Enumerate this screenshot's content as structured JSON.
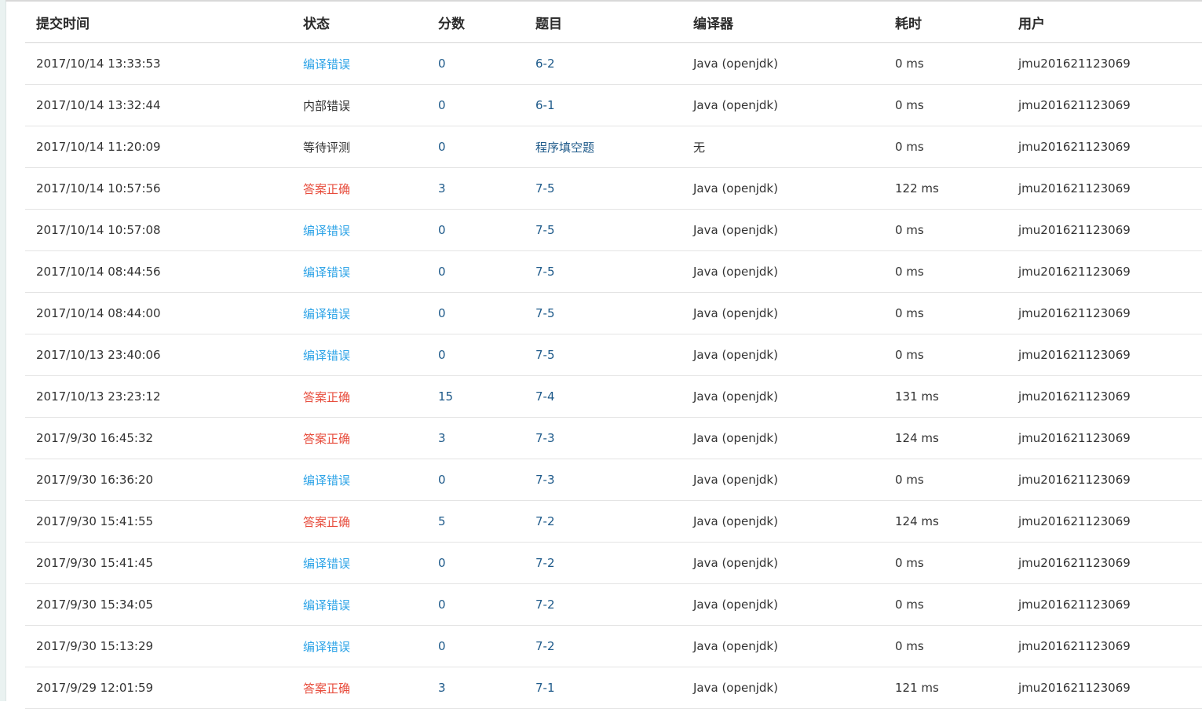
{
  "headers": {
    "time": "提交时间",
    "status": "状态",
    "score": "分数",
    "problem": "题目",
    "compiler": "编译器",
    "cost": "耗时",
    "user": "用户"
  },
  "rows": [
    {
      "time": "2017/10/14 13:33:53",
      "status": "编译错误",
      "status_type": "ce",
      "score": "0",
      "problem": "6-2",
      "compiler": "Java (openjdk)",
      "cost": "0 ms",
      "user": "jmu201621123069"
    },
    {
      "time": "2017/10/14 13:32:44",
      "status": "内部错误",
      "status_type": "other",
      "score": "0",
      "problem": "6-1",
      "compiler": "Java (openjdk)",
      "cost": "0 ms",
      "user": "jmu201621123069"
    },
    {
      "time": "2017/10/14 11:20:09",
      "status": "等待评测",
      "status_type": "other",
      "score": "0",
      "problem": "程序填空题",
      "compiler": "无",
      "cost": "0 ms",
      "user": "jmu201621123069"
    },
    {
      "time": "2017/10/14 10:57:56",
      "status": "答案正确",
      "status_type": "ac",
      "score": "3",
      "problem": "7-5",
      "compiler": "Java (openjdk)",
      "cost": "122 ms",
      "user": "jmu201621123069"
    },
    {
      "time": "2017/10/14 10:57:08",
      "status": "编译错误",
      "status_type": "ce",
      "score": "0",
      "problem": "7-5",
      "compiler": "Java (openjdk)",
      "cost": "0 ms",
      "user": "jmu201621123069"
    },
    {
      "time": "2017/10/14 08:44:56",
      "status": "编译错误",
      "status_type": "ce",
      "score": "0",
      "problem": "7-5",
      "compiler": "Java (openjdk)",
      "cost": "0 ms",
      "user": "jmu201621123069"
    },
    {
      "time": "2017/10/14 08:44:00",
      "status": "编译错误",
      "status_type": "ce",
      "score": "0",
      "problem": "7-5",
      "compiler": "Java (openjdk)",
      "cost": "0 ms",
      "user": "jmu201621123069"
    },
    {
      "time": "2017/10/13 23:40:06",
      "status": "编译错误",
      "status_type": "ce",
      "score": "0",
      "problem": "7-5",
      "compiler": "Java (openjdk)",
      "cost": "0 ms",
      "user": "jmu201621123069"
    },
    {
      "time": "2017/10/13 23:23:12",
      "status": "答案正确",
      "status_type": "ac",
      "score": "15",
      "problem": "7-4",
      "compiler": "Java (openjdk)",
      "cost": "131 ms",
      "user": "jmu201621123069"
    },
    {
      "time": "2017/9/30 16:45:32",
      "status": "答案正确",
      "status_type": "ac",
      "score": "3",
      "problem": "7-3",
      "compiler": "Java (openjdk)",
      "cost": "124 ms",
      "user": "jmu201621123069"
    },
    {
      "time": "2017/9/30 16:36:20",
      "status": "编译错误",
      "status_type": "ce",
      "score": "0",
      "problem": "7-3",
      "compiler": "Java (openjdk)",
      "cost": "0 ms",
      "user": "jmu201621123069"
    },
    {
      "time": "2017/9/30 15:41:55",
      "status": "答案正确",
      "status_type": "ac",
      "score": "5",
      "problem": "7-2",
      "compiler": "Java (openjdk)",
      "cost": "124 ms",
      "user": "jmu201621123069"
    },
    {
      "time": "2017/9/30 15:41:45",
      "status": "编译错误",
      "status_type": "ce",
      "score": "0",
      "problem": "7-2",
      "compiler": "Java (openjdk)",
      "cost": "0 ms",
      "user": "jmu201621123069"
    },
    {
      "time": "2017/9/30 15:34:05",
      "status": "编译错误",
      "status_type": "ce",
      "score": "0",
      "problem": "7-2",
      "compiler": "Java (openjdk)",
      "cost": "0 ms",
      "user": "jmu201621123069"
    },
    {
      "time": "2017/9/30 15:13:29",
      "status": "编译错误",
      "status_type": "ce",
      "score": "0",
      "problem": "7-2",
      "compiler": "Java (openjdk)",
      "cost": "0 ms",
      "user": "jmu201621123069"
    },
    {
      "time": "2017/9/29 12:01:59",
      "status": "答案正确",
      "status_type": "ac",
      "score": "3",
      "problem": "7-1",
      "compiler": "Java (openjdk)",
      "cost": "121 ms",
      "user": "jmu201621123069"
    }
  ],
  "colors": {
    "status_ce": "#2fa4e7",
    "status_ac": "#e74c3c",
    "link": "#1e5a8a"
  }
}
